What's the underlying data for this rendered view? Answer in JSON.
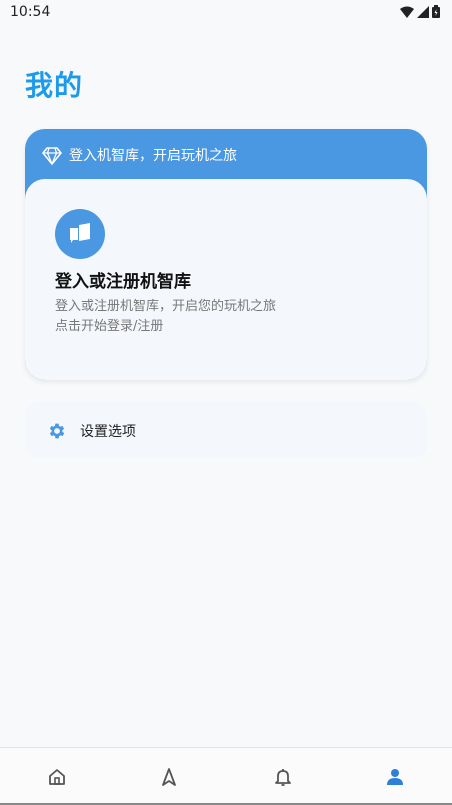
{
  "status_bar": {
    "time": "10:54"
  },
  "page": {
    "title": "我的"
  },
  "account_card": {
    "banner_text": "登入机智库，开启玩机之旅",
    "login_title": "登入或注册机智库",
    "login_desc_line1": "登入或注册机智库，开启您的玩机之旅",
    "login_desc_line2": "点击开始登录/注册"
  },
  "settings": {
    "label": "设置选项"
  },
  "bottom_nav": {
    "items": [
      {
        "icon": "home-icon"
      },
      {
        "icon": "navigate-icon"
      },
      {
        "icon": "bell-icon"
      },
      {
        "icon": "person-icon",
        "active": true
      }
    ]
  },
  "colors": {
    "accent": "#4a97e2",
    "title": "#1e9be8"
  }
}
